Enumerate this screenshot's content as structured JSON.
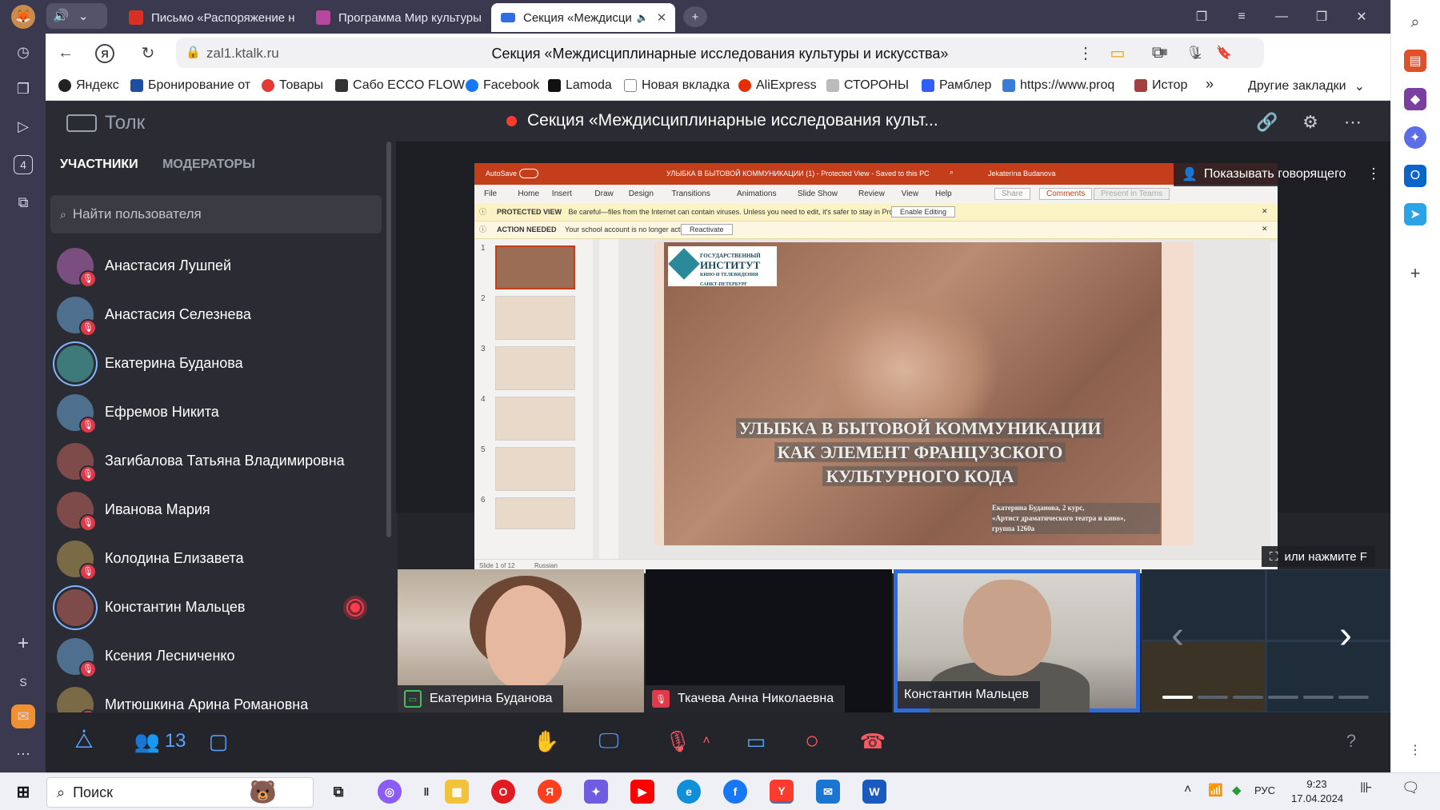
{
  "browser": {
    "tabs": [
      {
        "label": "Письмо «Распоряжение н",
        "color": "#d93025"
      },
      {
        "label": "Программа Мир культуры",
        "color": "#b7479e"
      },
      {
        "label": "Секция «Междисци",
        "color": "#2f6de1",
        "active": true
      }
    ],
    "address": {
      "host": "zal1.ktalk.ru",
      "page_title": "Секция «Междисциплинарные исследования культуры и искусства»"
    },
    "bookmarks": [
      {
        "label": "Яндекс",
        "color": "#222"
      },
      {
        "label": "Бронирование от",
        "color": "#1c4fa0"
      },
      {
        "label": "Товары",
        "color": "#e53935"
      },
      {
        "label": "Сабо ECCO FLOW",
        "color": "#333"
      },
      {
        "label": "Facebook",
        "color": "#1877f2"
      },
      {
        "label": "Lamoda",
        "color": "#111"
      },
      {
        "label": "Новая вкладка",
        "color": "#888"
      },
      {
        "label": "AliExpress",
        "color": "#e62e04"
      },
      {
        "label": "СТОРОНЫ",
        "color": "#999"
      },
      {
        "label": "Рамблер",
        "color": "#315efb"
      },
      {
        "label": "https://www.proq",
        "color": "#3a7bd5"
      },
      {
        "label": "Истор",
        "color": "#a04040"
      }
    ],
    "bookmarks_more": "»",
    "other_bookmarks": "Другие закладки",
    "left_panel_badge": "4",
    "left_panel_letter": "S"
  },
  "app": {
    "brand": "Толк",
    "conference_title": "Секция «Междисциплинарные исследования культ...",
    "sidebar": {
      "tabs": [
        "УЧАСТНИКИ",
        "МОДЕРАТОРЫ"
      ],
      "search_placeholder": "Найти пользователя",
      "participants": [
        {
          "name": "Анастасия Лушпей",
          "color": "#7a4f7f",
          "muted": true
        },
        {
          "name": "Анастасия Селезнева",
          "color": "#4f6f8f",
          "muted": true
        },
        {
          "name": "Екатерина Буданова",
          "color": "#3f7a7a",
          "muted": false,
          "ring": true
        },
        {
          "name": "Ефремов Никита",
          "color": "#4f6f8f",
          "muted": true
        },
        {
          "name": "Загибалова Татьяна Владимировна",
          "color": "#7f4a4a",
          "muted": true
        },
        {
          "name": "Иванова Мария",
          "color": "#7f4a4a",
          "muted": true
        },
        {
          "name": "Колодина Елизавета",
          "color": "#7a6a45",
          "muted": true
        },
        {
          "name": "Константин Мальцев",
          "color": "#7f4a4a",
          "muted": false,
          "ring": true,
          "recording": true
        },
        {
          "name": "Ксения Лесниченко",
          "color": "#4f6f8f",
          "muted": true
        },
        {
          "name": "Митюшкина Арина Романовна",
          "color": "#7a6a45",
          "muted": true
        }
      ]
    },
    "stage": {
      "show_speaker_label": "Показывать говорящего",
      "fullscreen_hint": "или нажмите F",
      "ppt": {
        "autosave": "AutoSave",
        "file_title": "УЛЫБКА В БЫТОВОЙ КОММУНИКАЦИИ (1) - Protected View - Saved to this PC",
        "user": "Jekaterina Budanova",
        "menu": [
          "File",
          "Home",
          "Insert",
          "Draw",
          "Design",
          "Transitions",
          "Animations",
          "Slide Show",
          "Review",
          "View",
          "Help"
        ],
        "share": "Share",
        "comments": "Comments",
        "present": "Present in Teams",
        "protected_label": "PROTECTED VIEW",
        "protected_text": "Be careful—files from the Internet can contain viruses. Unless you need to edit, it's safer to stay in Protected View.",
        "enable_editing": "Enable Editing",
        "action_label": "ACTION NEEDED",
        "action_text": "Your school account is no longer active.",
        "reactivate": "Reactivate",
        "slide_numbers": [
          "1",
          "2",
          "3",
          "4",
          "5",
          "6"
        ],
        "status_slide": "Slide 1 of 12",
        "status_lang": "Russian",
        "slide": {
          "logo_lines": [
            "ГОСУДАРСТВЕННЫЙ",
            "ИНСТИТУТ",
            "КИНО И ТЕЛЕВИДЕНИЯ",
            "САНКТ-ПЕТЕРБУРГ"
          ],
          "title_lines": [
            "УЛЫБКА В БЫТОВОЙ КОММУНИКАЦИИ",
            "КАК ЭЛЕМЕНТ ФРАНЦУЗСКОГО",
            "КУЛЬТУРНОГО КОДА"
          ],
          "author_lines": [
            "Екатерина Буданова, 2 курс,",
            "«Артист драматического театра и кино»,",
            "группа 1260а"
          ]
        }
      }
    },
    "tiles": [
      {
        "name": "Екатерина Буданова",
        "icon": "screen-share-icon"
      },
      {
        "name": "Ткачева Анна Николаевна",
        "icon": "mic-off-icon"
      },
      {
        "name": "Константин Мальцев",
        "icon": ""
      }
    ],
    "toolbar": {
      "participants_count": "13",
      "help": "?"
    }
  },
  "taskbar": {
    "search": "Поиск",
    "lang": "РУС",
    "time": "9:23",
    "date": "17.04.2024"
  }
}
